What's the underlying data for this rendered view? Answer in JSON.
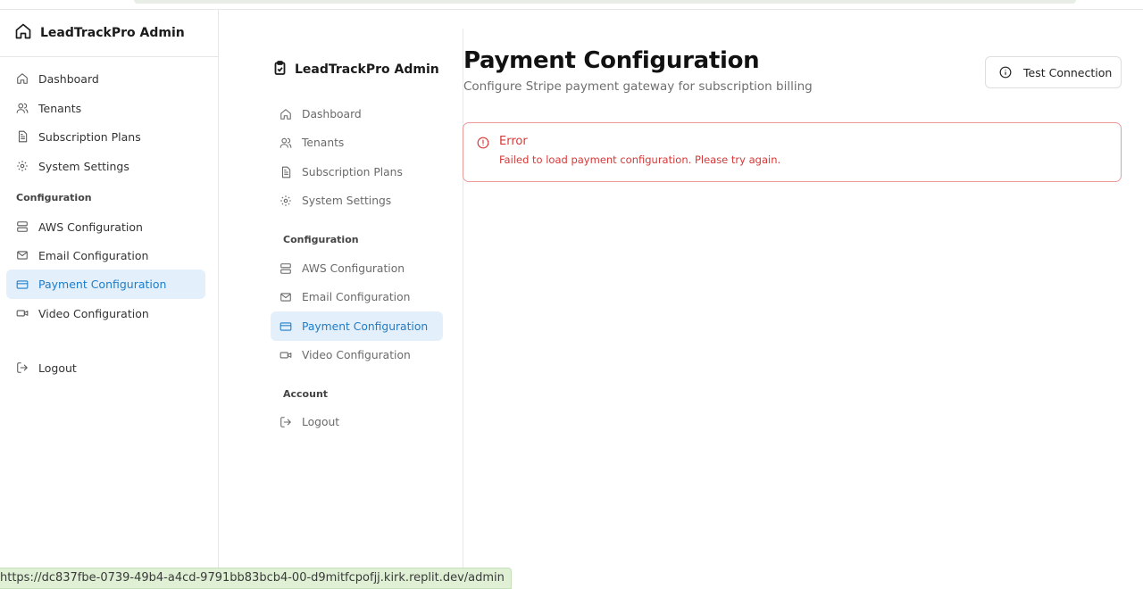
{
  "app": {
    "brand": "LeadTrackPro Admin"
  },
  "sidebar": {
    "items": [
      {
        "label": "Dashboard",
        "icon": "home-icon"
      },
      {
        "label": "Tenants",
        "icon": "users-icon"
      },
      {
        "label": "Subscription Plans",
        "icon": "file-icon"
      },
      {
        "label": "System Settings",
        "icon": "gear-icon"
      }
    ],
    "config_group_label": "Configuration",
    "config_items": [
      {
        "label": "AWS Configuration",
        "icon": "server-icon"
      },
      {
        "label": "Email Configuration",
        "icon": "mail-icon"
      },
      {
        "label": "Payment Configuration",
        "icon": "credit-card-icon"
      },
      {
        "label": "Video Configuration",
        "icon": "video-icon"
      }
    ],
    "account_group_label": "Account",
    "logout_label": "Logout"
  },
  "main": {
    "title": "Payment Configuration",
    "subtitle": "Configure Stripe payment gateway for subscription billing",
    "test_button_label": "Test Connection",
    "alert": {
      "title": "Error",
      "message": "Failed to load payment configuration. Please try again."
    }
  },
  "status_bar": {
    "url": "https://dc837fbe-0739-49b4-a4cd-9791bb83bcb4-00-d9mitfcpofjj.kirk.replit.dev/admin"
  },
  "colors": {
    "accent": "#1e7cc8",
    "active_bg": "#e3f0fb",
    "error": "#d63838",
    "error_border": "#ec9a9a"
  }
}
